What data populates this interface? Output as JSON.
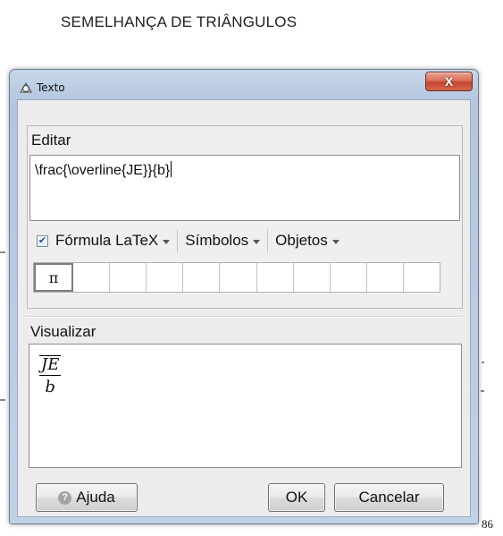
{
  "page": {
    "title": "SEMELHANÇA DE TRIÂNGULOS",
    "page_number": "86"
  },
  "dialog": {
    "title": "Texto",
    "close_glyph": "X",
    "edit_section": {
      "label": "Editar",
      "input_value": "\\frac{\\overline{JE}}{b}",
      "latex_checkbox_checked": true,
      "latex_label": "Fórmula LaTeX",
      "symbols_label": "Símbolos",
      "objects_label": "Objetos",
      "symbol_cells": [
        "π",
        "",
        "",
        "",
        "",
        "",
        "",
        "",
        "",
        "",
        ""
      ]
    },
    "preview_section": {
      "label": "Visualizar",
      "numerator": "JE",
      "denominator": "b"
    },
    "buttons": {
      "help": "Ajuda",
      "ok": "OK",
      "cancel": "Cancelar"
    }
  },
  "colors": {
    "titlebar": "#bccde3",
    "close_button": "#c6452f",
    "client_background": "#ececec"
  },
  "icons": {
    "title": "shapes-icon",
    "help": "question-icon",
    "dropdown": "chevron-down-icon"
  }
}
